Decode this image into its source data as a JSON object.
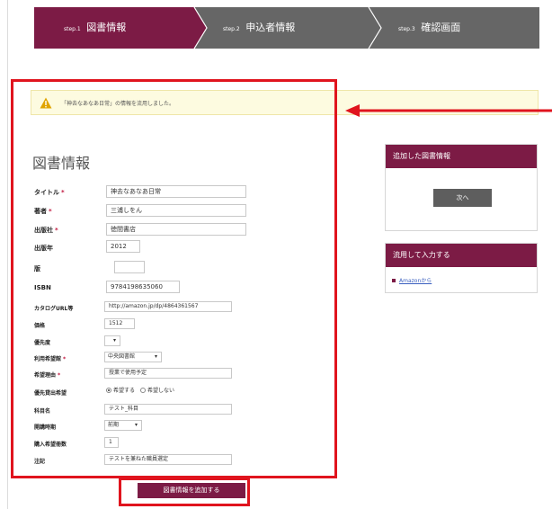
{
  "steps": [
    {
      "num": "step.1",
      "label": "図書情報",
      "active": true
    },
    {
      "num": "step.2",
      "label": "申込者情報",
      "active": false
    },
    {
      "num": "step.3",
      "label": "確認画面",
      "active": false
    }
  ],
  "notice": {
    "text": "「神去なあなあ日常」の情報を流用しました。"
  },
  "section_title": "図書情報",
  "fields": {
    "title": {
      "label": "タイトル",
      "value": "神去なあなあ日常"
    },
    "author": {
      "label": "著者",
      "value": "三浦しをん"
    },
    "publisher": {
      "label": "出版社",
      "value": "徳間書店"
    },
    "pub_year": {
      "label": "出版年",
      "value": "2012"
    },
    "edition": {
      "label": "版",
      "value": ""
    },
    "isbn": {
      "label": "ISBN",
      "value": "9784198635060"
    },
    "catalog_url": {
      "label": "カタログURL等",
      "value": "http://amazon.jp/dp/4864361567"
    },
    "price": {
      "label": "価格",
      "value": "1512"
    },
    "priority": {
      "label": "優先度",
      "value": ""
    },
    "library": {
      "label": "利用希望館",
      "value": "中央図書館"
    },
    "reason": {
      "label": "希望理由",
      "value": "授業で使用予定"
    },
    "priority_lending": {
      "label": "優先貸出希望",
      "option_yes": "希望する",
      "option_no": "希望しない",
      "selected": "yes"
    },
    "subject": {
      "label": "科目名",
      "value": "テスト_科目"
    },
    "period": {
      "label": "開講時期",
      "value": "前期"
    },
    "copies": {
      "label": "購入希望冊数",
      "value": "1"
    },
    "notes": {
      "label": "注記",
      "value": "テストを兼ねた職員選定"
    }
  },
  "required_mark": "*",
  "add_button": "図書情報を追加する",
  "right": {
    "added_panel_title": "追加した図書情報",
    "next_button": "次へ",
    "reuse_panel_title": "流用して入力する",
    "reuse_link": "Amazonから"
  },
  "colors": {
    "brand": "#7c1b45",
    "annotation": "#e0141e",
    "inactive_step": "#666666"
  }
}
